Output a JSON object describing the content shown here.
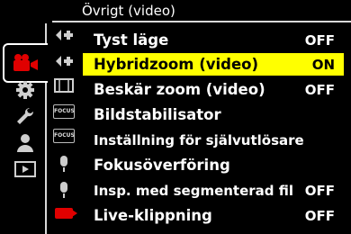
{
  "header": {
    "title": "Övrigt (video)"
  },
  "categories": [
    {
      "name": "video-camera-icon",
      "active": true
    },
    {
      "name": "gear-icon"
    },
    {
      "name": "wrench-icon"
    },
    {
      "name": "person-icon"
    },
    {
      "name": "playback-icon"
    }
  ],
  "subtabs": [
    {
      "name": "dpad-plus-icon"
    },
    {
      "name": "dpad-plus-icon-2"
    },
    {
      "name": "film-frame-icon"
    },
    {
      "name": "focus-box-icon",
      "text": "FOCUS"
    },
    {
      "name": "focus-box-icon-2",
      "text": "FOCUS"
    },
    {
      "name": "microphone-icon"
    },
    {
      "name": "microphone-icon-2"
    },
    {
      "name": "red-camera-icon"
    }
  ],
  "menu": {
    "items": [
      {
        "label": "Tyst läge",
        "value": "OFF"
      },
      {
        "label": "Hybridzoom (video)",
        "value": "ON",
        "selected": true
      },
      {
        "label": "Beskär zoom (video)",
        "value": "OFF"
      },
      {
        "label": "Bildstabilisator",
        "value": ""
      },
      {
        "label": "Inställning för självutlösare",
        "value": ""
      },
      {
        "label": "Fokusöverföring",
        "value": ""
      },
      {
        "label": "Insp. med segmenterad fil",
        "value": "OFF"
      },
      {
        "label": "Live-klippning",
        "value": "OFF"
      }
    ]
  },
  "colors": {
    "highlight": "#ffff00",
    "accent_red": "#e00000"
  }
}
